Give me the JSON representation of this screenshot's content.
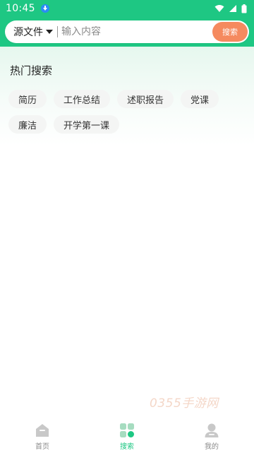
{
  "status_bar": {
    "time": "10:45"
  },
  "search": {
    "source_label": "源文件",
    "placeholder": "输入内容",
    "button_label": "搜索"
  },
  "hot": {
    "title": "热门搜索",
    "rows": [
      [
        "简历",
        "工作总结",
        "述职报告",
        "党课"
      ],
      [
        "廉洁",
        "开学第一课"
      ]
    ]
  },
  "watermark": "0355手游网",
  "tabbar": {
    "items": [
      {
        "label": "首页",
        "icon": "home-icon"
      },
      {
        "label": "搜索",
        "icon": "search-tab-icon"
      },
      {
        "label": "我的",
        "icon": "profile-icon"
      }
    ],
    "active_index": 1
  },
  "colors": {
    "brand": "#1ec783",
    "search_button": "#f58a5f",
    "chip_bg": "#f4f5f4"
  }
}
